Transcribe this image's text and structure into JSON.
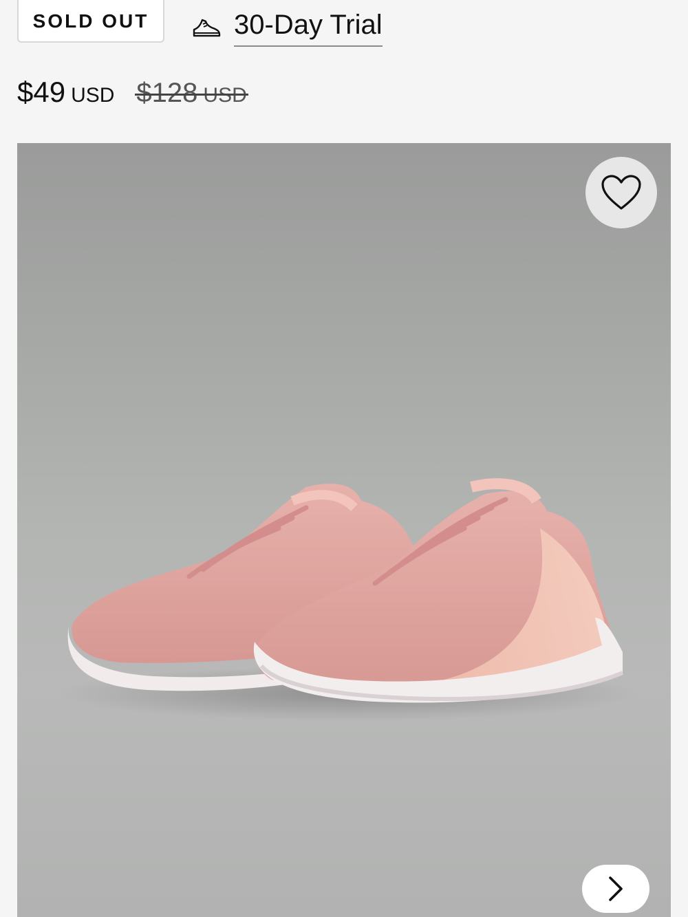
{
  "status_badge": "SOLD OUT",
  "trial": {
    "icon": "running-shoe-icon",
    "label": "30-Day Trial"
  },
  "price": {
    "current": "$49",
    "current_currency": "USD",
    "original": "$128",
    "original_currency": "USD"
  },
  "gallery": {
    "image": "pink-running-shoes-image",
    "wishlist_icon": "heart-icon",
    "next_icon": "chevron-right-icon"
  },
  "colors": {
    "background": "#f6f5f5",
    "shoe_pink": "#e2a6a1",
    "sole_white": "#f3eeee"
  }
}
